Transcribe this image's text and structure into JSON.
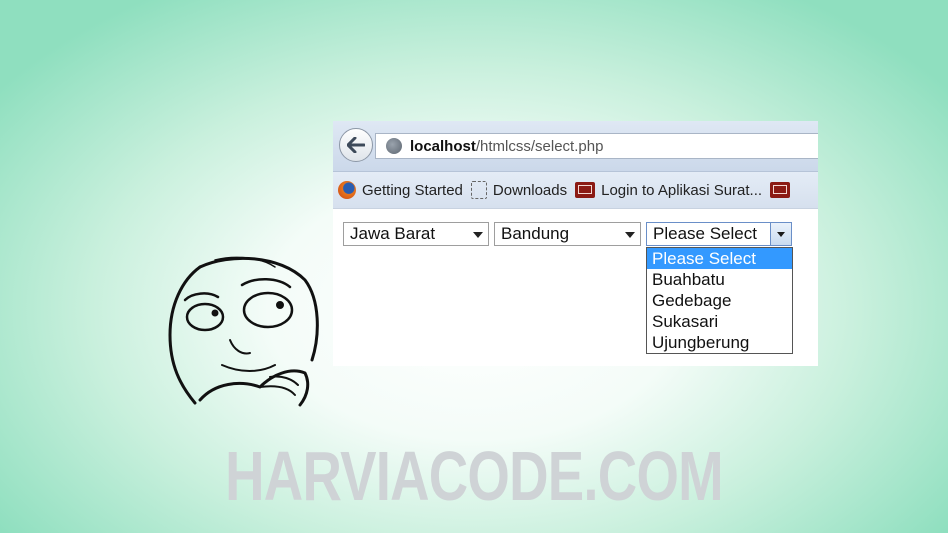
{
  "browser": {
    "url_host": "localhost",
    "url_path": "/htmlcss/select.php",
    "bookmarks": [
      {
        "label": "Getting Started",
        "icon": "firefox-icon"
      },
      {
        "label": "Downloads",
        "icon": "downloads-icon"
      },
      {
        "label": "Login to Aplikasi Surat...",
        "icon": "mail-icon"
      },
      {
        "label": "",
        "icon": "mail-icon"
      }
    ]
  },
  "form": {
    "province_value": "Jawa Barat",
    "city_value": "Bandung",
    "district_value": "Please Select",
    "district_options": [
      "Please Select",
      "Buahbatu",
      "Gedebage",
      "Sukasari",
      "Ujungberung"
    ],
    "highlighted_option": "Please Select"
  },
  "brand": {
    "text": "HARVIACODE.COM"
  },
  "colors": {
    "background_edge": "#8fdfbf",
    "highlight": "#3399ff",
    "brand_text": "#cfd3d6"
  }
}
